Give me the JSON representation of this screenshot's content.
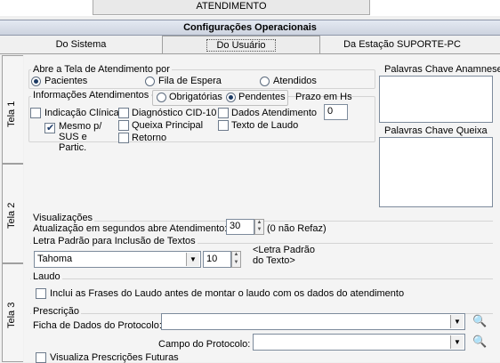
{
  "window": {
    "tab_title": "ATENDIMENTO"
  },
  "header": {
    "title": "Configurações Operacionais"
  },
  "tabs": [
    {
      "label": "Do Sistema",
      "active": false
    },
    {
      "label": "Do Usuário",
      "active": true
    },
    {
      "label": "Da Estação SUPORTE-PC",
      "active": false
    }
  ],
  "side_tabs": [
    "Tela 1",
    "Tela 2",
    "Tela 3"
  ],
  "abre_tela": {
    "legend": "Abre a Tela de Atendimento por",
    "options": [
      "Pacientes",
      "Fila de Espera",
      "Atendidos"
    ],
    "selected": "Pacientes"
  },
  "info_atend": {
    "legend": "Informações Atendimentos -",
    "options": [
      "Obrigatórias",
      "Pendentes"
    ],
    "selected": "Pendentes",
    "prazo_label": "Prazo em Hs",
    "prazo_value": "0",
    "checks": {
      "indicacao": "Indicação Clínica",
      "mesmo_sus": "Mesmo p/ SUS e Partic.",
      "diagnostico": "Diagnóstico CID-10",
      "queixa": "Queixa Principal",
      "retorno": "Retorno",
      "dados": "Dados Atendimento",
      "texto_laudo": "Texto de Laudo"
    }
  },
  "palavras": {
    "anamnese": "Palavras Chave Anamnese",
    "queixa": "Palavras Chave Queixa"
  },
  "visualizacoes": {
    "legend": "Visualizações",
    "label": "Atualização em segundos abre Atendimento:",
    "value": "30",
    "note": "(0 não Refaz)"
  },
  "letra": {
    "legend": "Letra Padrão para Inclusão de Textos",
    "font": "Tahoma",
    "size": "10",
    "preview": "<Letra Padrão do Texto>"
  },
  "laudo": {
    "legend": "Laudo",
    "checkbox": "Inclui as Frases do Laudo antes de montar o laudo com os dados do atendimento"
  },
  "prescricao": {
    "legend": "Prescrição",
    "ficha_label": "Ficha de Dados do Protocolo:",
    "campo_label": "Campo do Protocolo:",
    "futuras": "Visualiza Prescrições Futuras"
  }
}
